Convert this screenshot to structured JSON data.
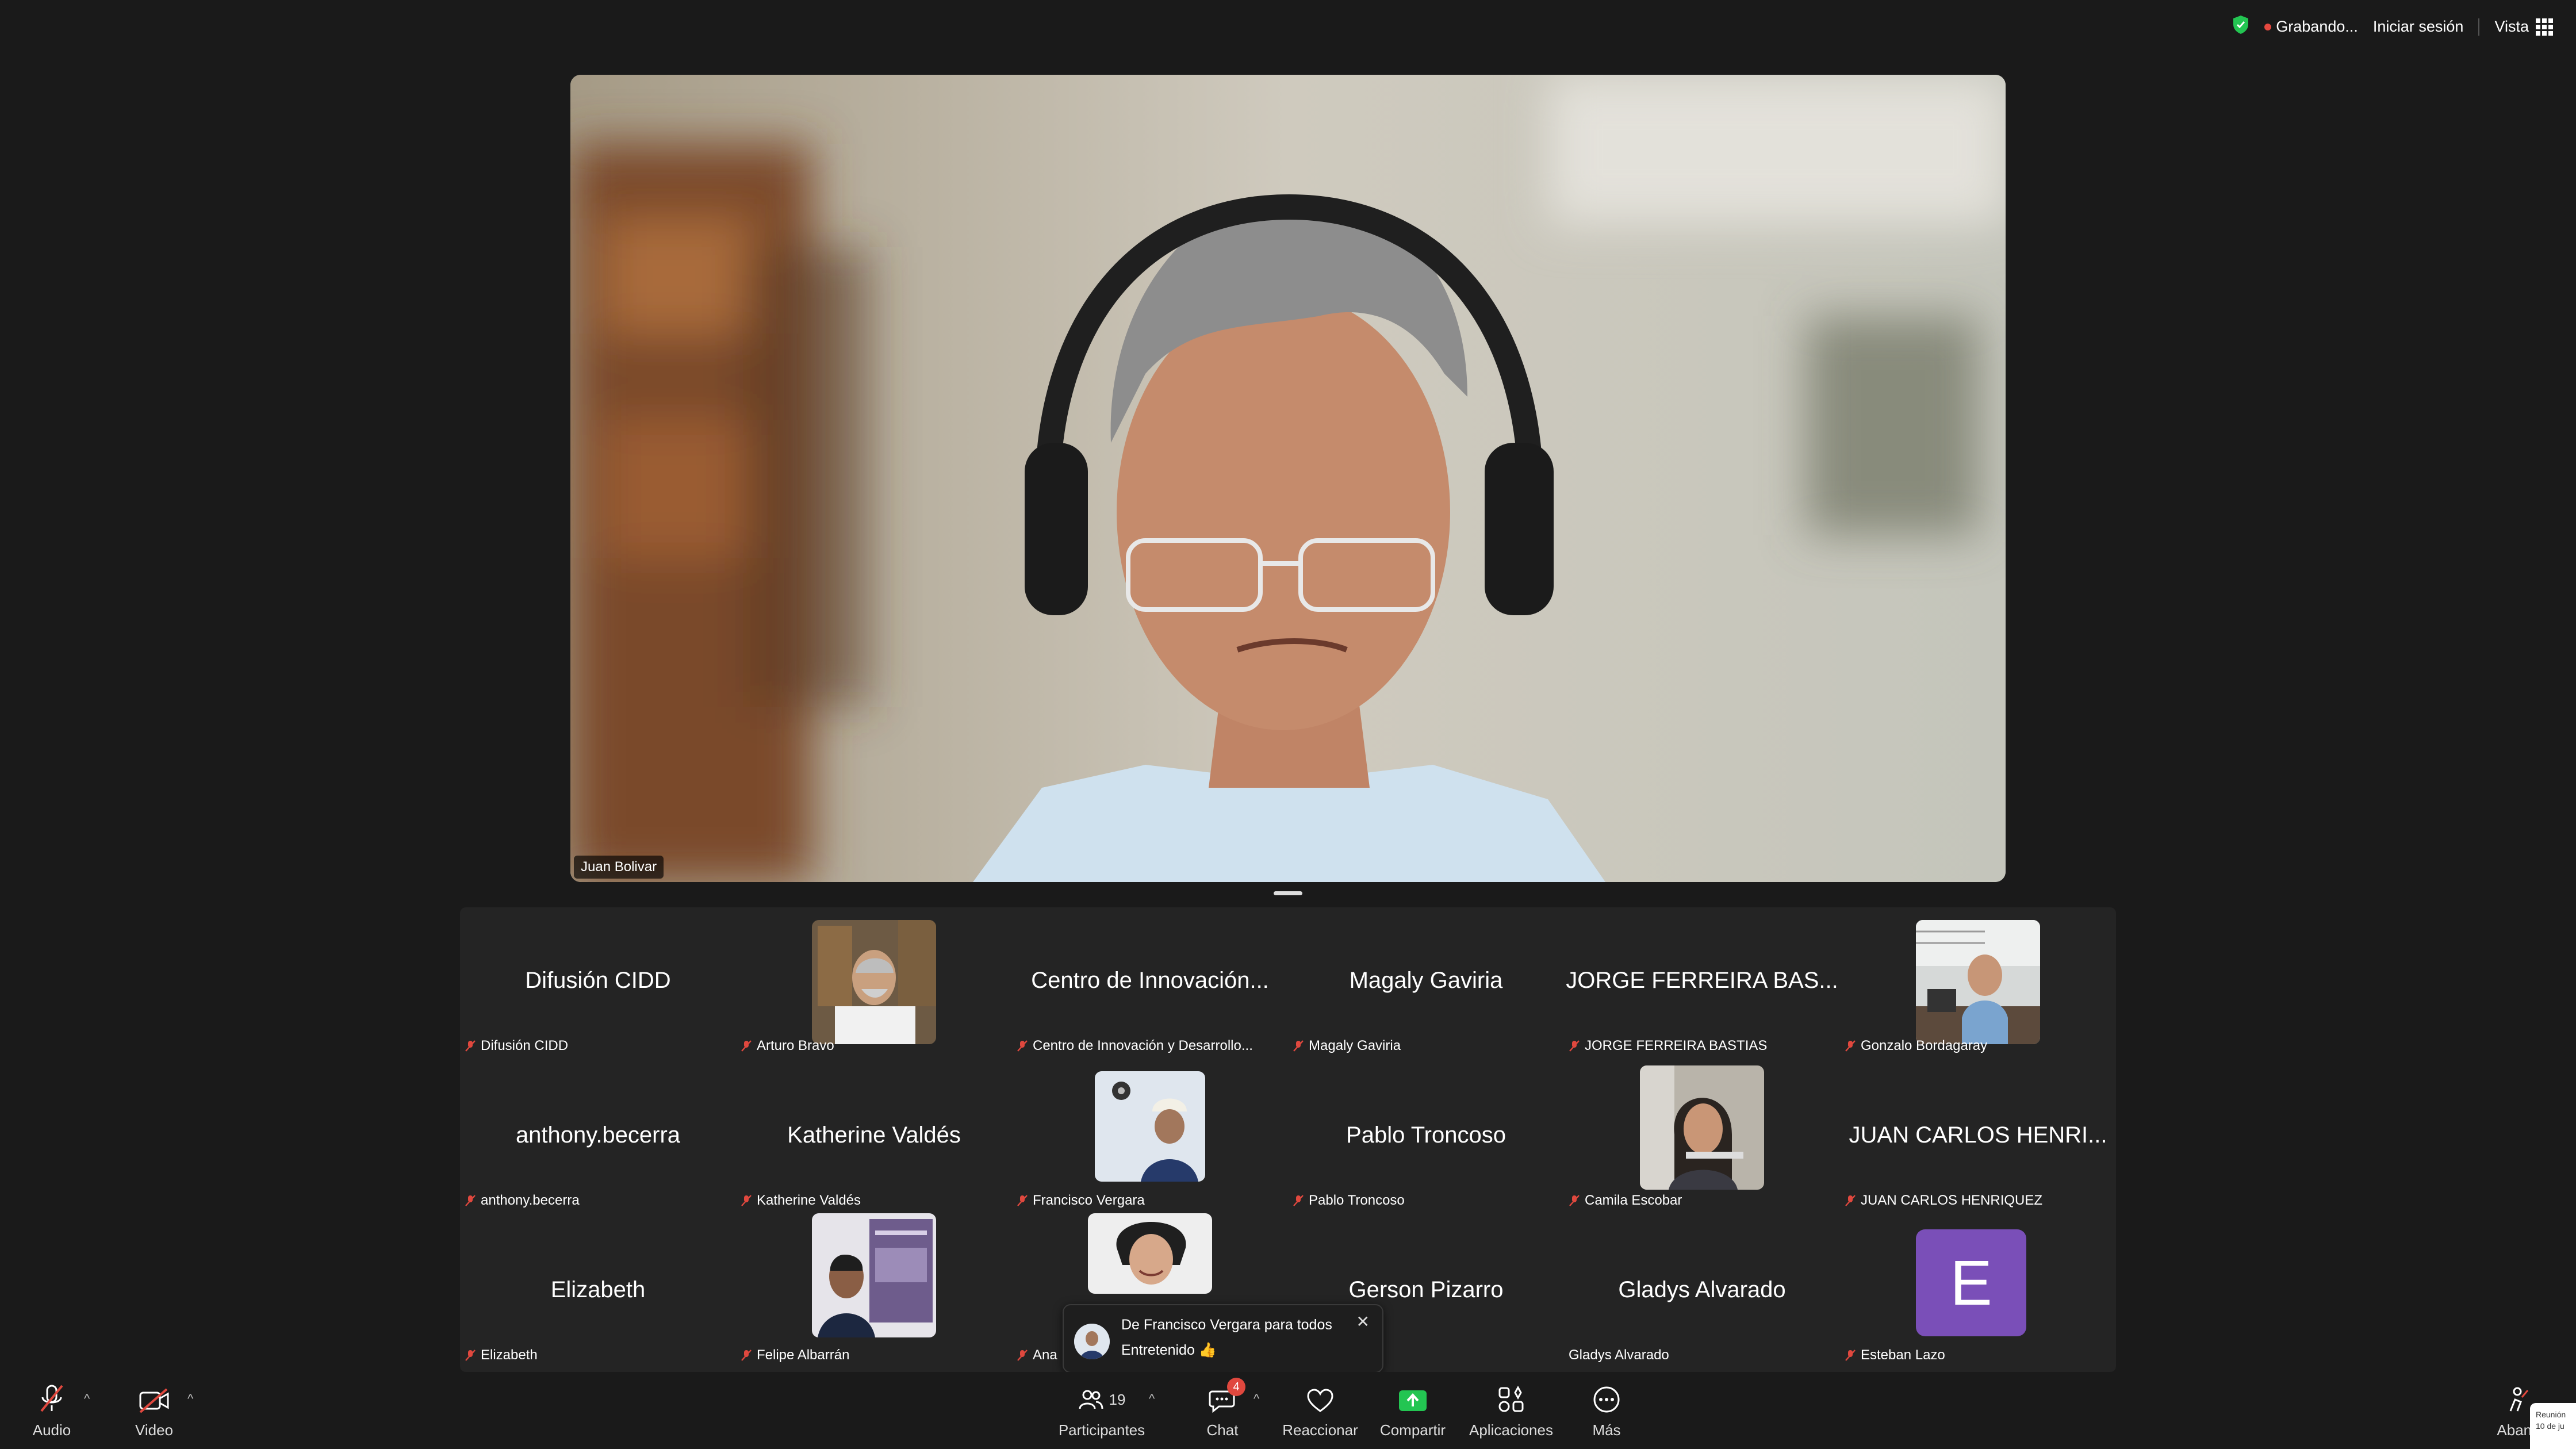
{
  "topbar": {
    "recording_label": "Grabando...",
    "signin_label": "Iniciar sesión",
    "view_label": "Vista"
  },
  "speaker": {
    "name": "Juan Bolivar"
  },
  "gallery": {
    "tiles": [
      {
        "display": "Difusión CIDD",
        "label": "Difusión CIDD"
      },
      {
        "display": "",
        "label": "Arturo Bravo"
      },
      {
        "display": "Centro de Innovación...",
        "label": "Centro de Innovación y Desarrollo..."
      },
      {
        "display": "Magaly Gaviria",
        "label": "Magaly Gaviria"
      },
      {
        "display": "JORGE FERREIRA BAS...",
        "label": "JORGE FERREIRA BASTIAS"
      },
      {
        "display": "",
        "label": "Gonzalo Bordagaray"
      },
      {
        "display": "anthony.becerra",
        "label": "anthony.becerra"
      },
      {
        "display": "Katherine Valdés",
        "label": "Katherine Valdés"
      },
      {
        "display": "",
        "label": "Francisco Vergara"
      },
      {
        "display": "Pablo Troncoso",
        "label": "Pablo Troncoso"
      },
      {
        "display": "",
        "label": "Camila Escobar"
      },
      {
        "display": "JUAN CARLOS HENRI...",
        "label": "JUAN CARLOS HENRIQUEZ"
      },
      {
        "display": "Elizabeth",
        "label": "Elizabeth"
      },
      {
        "display": "",
        "label": "Felipe Albarrán"
      },
      {
        "display": "",
        "label": "Ana"
      },
      {
        "display": "Gerson Pizarro",
        "label": "arro"
      },
      {
        "display": "Gladys Alvarado",
        "label": "Gladys Alvarado"
      },
      {
        "display": "E",
        "label": "Esteban Lazo"
      }
    ]
  },
  "chat_popup": {
    "from": "De Francisco Vergara para todos",
    "message": "Entretenido 👍"
  },
  "toolbar": {
    "audio": "Audio",
    "video": "Video",
    "participants": "Participantes",
    "participants_count": "19",
    "chat": "Chat",
    "chat_badge": "4",
    "react": "Reaccionar",
    "share": "Compartir",
    "apps": "Aplicaciones",
    "more": "Más",
    "leave": "Aband"
  },
  "corner_card": {
    "line1": "Reunión",
    "line2": "10 de ju"
  },
  "colors": {
    "background": "#1a1a1a",
    "gallery_bg": "#242424",
    "mute_red": "#e0483e",
    "share_green": "#23c552",
    "avatar_purple": "#7a4fb8"
  }
}
